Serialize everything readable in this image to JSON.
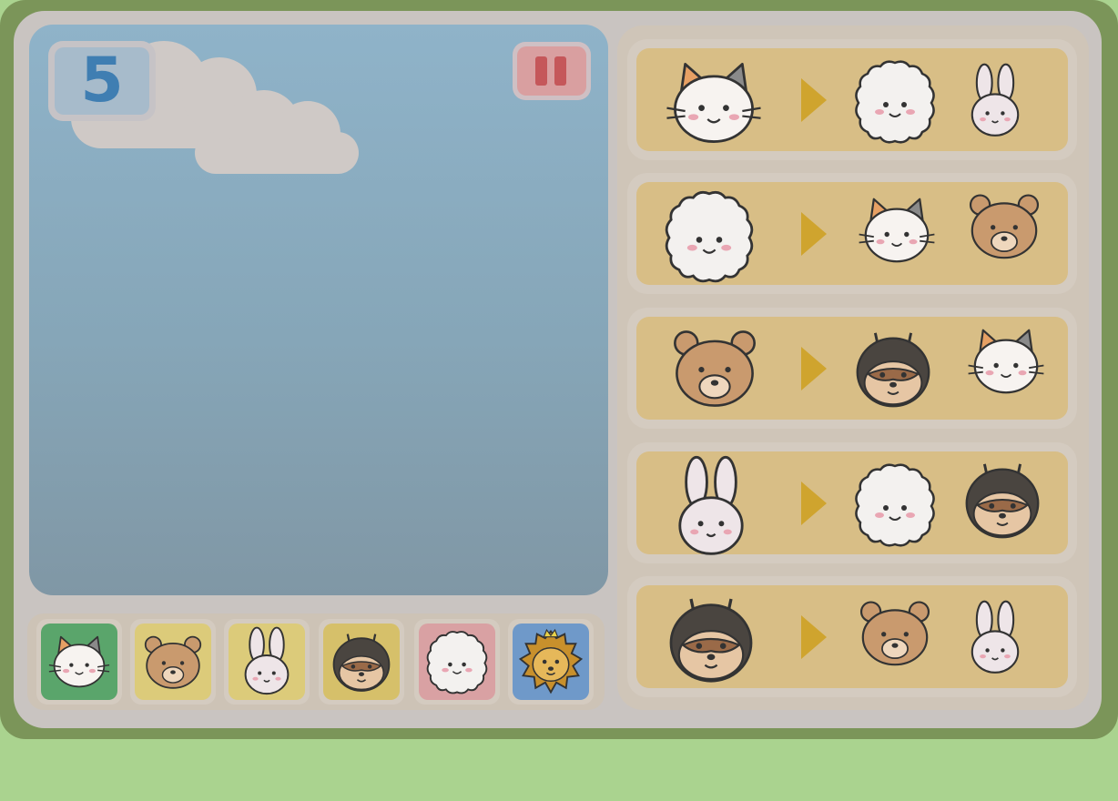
{
  "game": {
    "counter_value": "5",
    "pause_icon": "pause-icon"
  },
  "palette": [
    {
      "animal": "cat",
      "tile_color": "#5aa56b",
      "icon": "cat-face-icon"
    },
    {
      "animal": "bear",
      "tile_color": "#dccb7a",
      "icon": "bear-face-icon"
    },
    {
      "animal": "rabbit",
      "tile_color": "#dccb7a",
      "icon": "rabbit-face-icon"
    },
    {
      "animal": "tanuki",
      "tile_color": "#d6c06a",
      "icon": "tanuki-face-icon"
    },
    {
      "animal": "sheep",
      "tile_color": "#d9a1a3",
      "icon": "sheep-face-icon"
    },
    {
      "animal": "lion",
      "tile_color": "#6f99c9",
      "icon": "lion-face-icon"
    }
  ],
  "rules": [
    {
      "from": "cat",
      "to": [
        "sheep",
        "rabbit"
      ]
    },
    {
      "from": "sheep",
      "to": [
        "cat",
        "bear"
      ]
    },
    {
      "from": "bear",
      "to": [
        "tanuki",
        "cat"
      ]
    },
    {
      "from": "rabbit",
      "to": [
        "sheep",
        "tanuki"
      ]
    },
    {
      "from": "tanuki",
      "to": [
        "bear",
        "rabbit"
      ]
    }
  ],
  "colors": {
    "background": "#aad38f",
    "frame": "#7b9559",
    "board": "#c9c4c1",
    "rule_card": "#d8be86",
    "arrow": "#cfa42e",
    "counter_text": "#3f7eb2",
    "pause_bars": "#c5575a"
  }
}
